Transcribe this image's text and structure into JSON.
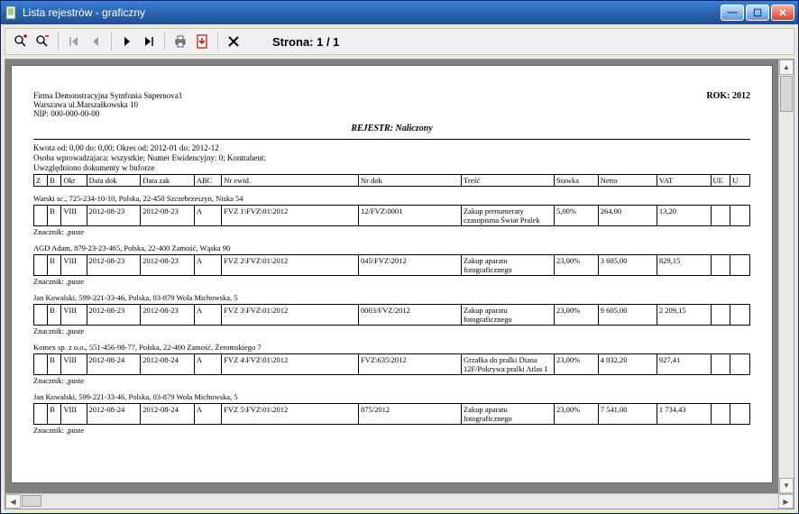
{
  "window": {
    "title": "Lista rejestrów - graficzny"
  },
  "toolbar": {
    "page_label": "Strona: 1 / 1"
  },
  "report": {
    "company": "Firma Demonstracyjna Symfonia Supernova1",
    "address": "Warszawa ul.Marszałkowska 10",
    "nip": "NIP: 000-000-00-00",
    "year_label": "ROK: 2012",
    "title": "REJESTR: Naliczony",
    "filters_line1": "Kwota od: 0,00 do: 0,00; Okres od: 2012-01 do: 2012-12",
    "filters_line2": "Osoba wprowadzajaca: wszystkie; Numer Ewidencyjny: 0; Kontrahent:",
    "filters_line3": "Uwzględniono dokumenty w buforze",
    "columns": {
      "z": "Z",
      "b": "B",
      "okr": "Okr",
      "data_dok": "Data dok",
      "data_zak": "Data zak",
      "abc": "ABC",
      "nr_ewid": "Nr ewid.",
      "nr_dok": "Nr dok",
      "tresc": "Treść",
      "stawka": "Stawka",
      "netto": "Netto",
      "vat": "VAT",
      "ue": "UE",
      "u": "U"
    },
    "znacznik_label": "Znacznik: ,puste",
    "sections": [
      {
        "header": "Warski sc., 725-234-10-10, Polska, 22-450 Szczebrzeszyn, Niska 54",
        "rows": [
          {
            "z": "",
            "b": "B",
            "okr": "VIII",
            "data_dok": "2012-08-23",
            "data_zak": "2012-08-23",
            "abc": "A",
            "nr_ewid": "FVZ  1\\FVZ\\01\\2012",
            "nr_dok": "12/FVZ\\0001",
            "tresc": "Zakup prenumeraty czasopisma Świat Pralek",
            "stawka": "5,00%",
            "netto": "264,00",
            "vat": "13,20",
            "ue": "",
            "u": ""
          }
        ]
      },
      {
        "header": "AGD Adam, 879-23-23-465, Polska, 22-400 Zamość, Wąska 90",
        "rows": [
          {
            "z": "",
            "b": "B",
            "okr": "VIII",
            "data_dok": "2012-08-23",
            "data_zak": "2012-08-23",
            "abc": "A",
            "nr_ewid": "FVZ  2\\FVZ\\01\\2012",
            "nr_dok": "045\\FVZ\\2012",
            "tresc": "Zakup aparatu fotograficznego",
            "stawka": "23,00%",
            "netto": "3 605,00",
            "vat": "829,15",
            "ue": "",
            "u": ""
          }
        ]
      },
      {
        "header": "Jan Kowalski, 599-221-33-46, Polska, 03-879 Wola Michowska,  5",
        "rows": [
          {
            "z": "",
            "b": "B",
            "okr": "VIII",
            "data_dok": "2012-08-23",
            "data_zak": "2012-08-23",
            "abc": "A",
            "nr_ewid": "FVZ  3\\FVZ\\01\\2012",
            "nr_dok": "0003/FVZ/2012",
            "tresc": "Zakup aparatu fotograficznego",
            "stawka": "23,00%",
            "netto": "9 605,00",
            "vat": "2 209,15",
            "ue": "",
            "u": ""
          }
        ]
      },
      {
        "header": "Komex sp. z o.o., 551-456-98-77, Polska, 22-400 Zamość, Żeromskiego 7",
        "rows": [
          {
            "z": "",
            "b": "B",
            "okr": "VIII",
            "data_dok": "2012-08-24",
            "data_zak": "2012-08-24",
            "abc": "A",
            "nr_ewid": "FVZ  4\\FVZ\\01\\2012",
            "nr_dok": "FVZ\\635\\2012",
            "tresc": "Grzałka do pralki Diana 12F/Pokrywa pralki Atlas 1",
            "stawka": "23,00%",
            "netto": "4 032,20",
            "vat": "927,41",
            "ue": "",
            "u": ""
          }
        ]
      },
      {
        "header": "Jan Kowalski, 599-221-33-46, Polska, 03-879 Wola Michowska,  5",
        "rows": [
          {
            "z": "",
            "b": "B",
            "okr": "VIII",
            "data_dok": "2012-08-24",
            "data_zak": "2012-08-24",
            "abc": "A",
            "nr_ewid": "FVZ  5\\FVZ\\01\\2012",
            "nr_dok": "875/2012",
            "tresc": "Zakup aparatu fotograficznego",
            "stawka": "23,00%",
            "netto": "7 541,00",
            "vat": "1 734,43",
            "ue": "",
            "u": ""
          }
        ]
      }
    ]
  }
}
